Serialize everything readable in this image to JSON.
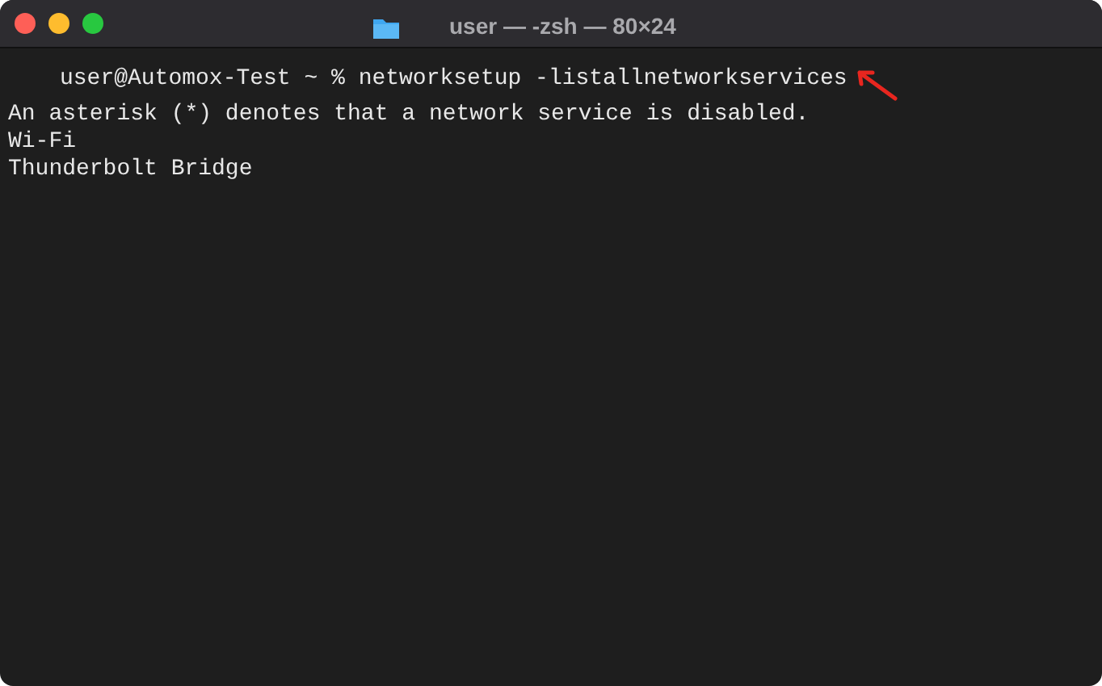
{
  "window": {
    "title": "user — -zsh — 80×24"
  },
  "terminal": {
    "lines": [
      {
        "kind": "prompt",
        "text": "user@Automox-Test ~ % networksetup -listallnetworkservices"
      },
      {
        "kind": "output",
        "text": "An asterisk (*) denotes that a network service is disabled."
      },
      {
        "kind": "output",
        "text": "Wi-Fi"
      },
      {
        "kind": "output",
        "text": "Thunderbolt Bridge"
      }
    ]
  }
}
